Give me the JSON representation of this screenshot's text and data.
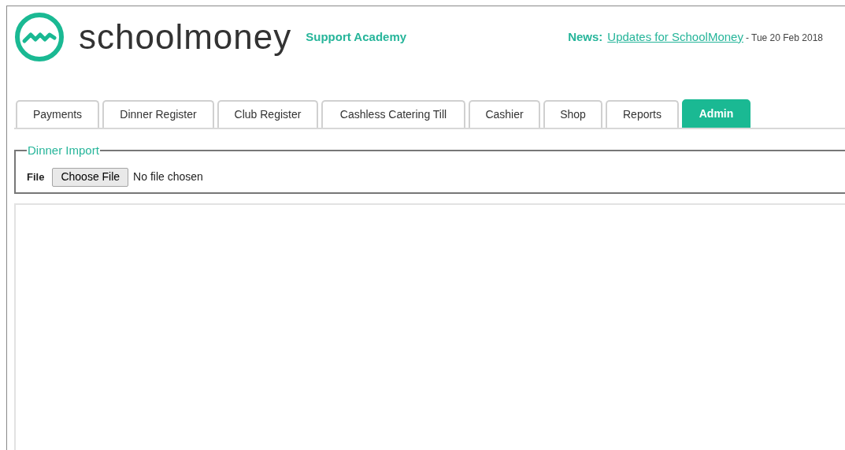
{
  "header": {
    "logo_text": "schoolmoney",
    "school": "Support Academy",
    "news_label": "News:",
    "news_link": "Updates for SchoolMoney",
    "news_date": "- Tue 20 Feb 2018"
  },
  "tabs": [
    {
      "label": "Payments",
      "selected": false
    },
    {
      "label": "Dinner Register",
      "selected": false
    },
    {
      "label": "Club Register",
      "selected": false
    },
    {
      "label": "Cashless Catering Till",
      "selected": false
    },
    {
      "label": "Cashier",
      "selected": false
    },
    {
      "label": "Shop",
      "selected": false
    },
    {
      "label": "Reports",
      "selected": false
    },
    {
      "label": "Admin",
      "selected": true
    }
  ],
  "dinner_import": {
    "legend": "Dinner Import",
    "file_label": "File",
    "button": "Choose File",
    "status": "No file chosen"
  }
}
